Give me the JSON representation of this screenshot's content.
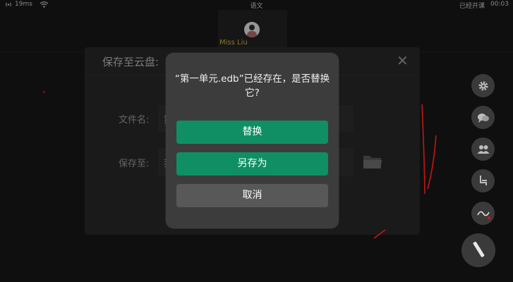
{
  "status_bar": {
    "latency": "19ms",
    "subject": "语文",
    "class_status": "已经开课",
    "time": "00:03"
  },
  "video_tile": {
    "name": "Miss Liu"
  },
  "save_panel": {
    "title": "保存至云盘:",
    "filename_label": "文件名:",
    "filename_visible": "第",
    "save_to_label": "保存至:",
    "save_to_visible": "我"
  },
  "dialog": {
    "message": "“第一单元.edb”已经存在，是否替换它?",
    "replace_label": "替换",
    "save_as_label": "另存为",
    "cancel_label": "取消"
  },
  "toolbar": {
    "icons": [
      "gear-icon",
      "chat-icon",
      "people-icon",
      "seat-icon",
      "curve-icon",
      "pen-icon"
    ]
  },
  "colors": {
    "background": "#171717",
    "dialog_bg": "#3c3c3c",
    "primary_green": "#0f8f63",
    "cancel_gray": "#585858",
    "name_gold": "#d7b24a",
    "ink_red": "#d11111"
  }
}
